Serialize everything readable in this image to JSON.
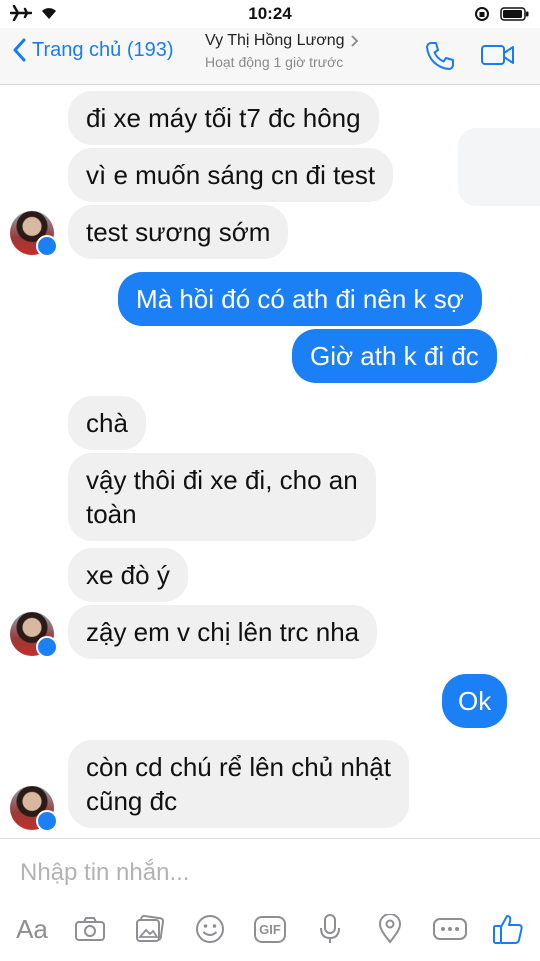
{
  "status_bar": {
    "time": "10:24"
  },
  "header": {
    "back_label": "Trang chủ (193)",
    "contact_name": "Vy Thị Hồng Lương",
    "activity": "Hoạt động 1 giờ trước"
  },
  "messages": [
    {
      "text": "đi xe máy tối t7 đc hông",
      "from": "them"
    },
    {
      "text": "vì e muốn sáng cn đi test",
      "from": "them"
    },
    {
      "text": "test sương sớm",
      "from": "them"
    },
    {
      "text": "Mà hồi đó có ath đi nên k sợ",
      "from": "me"
    },
    {
      "text": "Giờ ath k đi đc",
      "from": "me"
    },
    {
      "text": "chà",
      "from": "them"
    },
    {
      "line1": "vậy thôi đi xe đi, cho an",
      "line2": "toàn",
      "from": "them"
    },
    {
      "text": "xe đò ý",
      "from": "them"
    },
    {
      "text": "zậy em v chị lên trc nha",
      "from": "them"
    },
    {
      "text": "Ok",
      "from": "me"
    },
    {
      "line1": "còn cd chú rể lên chủ nhật",
      "line2": "cũng đc",
      "from": "them"
    }
  ],
  "composer": {
    "placeholder": "Nhập tin nhắn...",
    "aa_label": "Aa",
    "gif_label": "GIF"
  },
  "colors": {
    "outgoing": "#1b7ff5",
    "incoming": "#f1f0f0",
    "accent": "#1a7cf5",
    "icon_gray": "#8e8e93"
  },
  "icons": [
    "airplane-icon",
    "wifi-icon",
    "lock-rotation-icon",
    "battery-icon",
    "back-chevron-icon",
    "phone-icon",
    "video-camera-icon",
    "camera-icon",
    "gallery-icon",
    "emoji-icon",
    "gif-icon",
    "microphone-icon",
    "location-icon",
    "more-icon",
    "like-icon"
  ]
}
